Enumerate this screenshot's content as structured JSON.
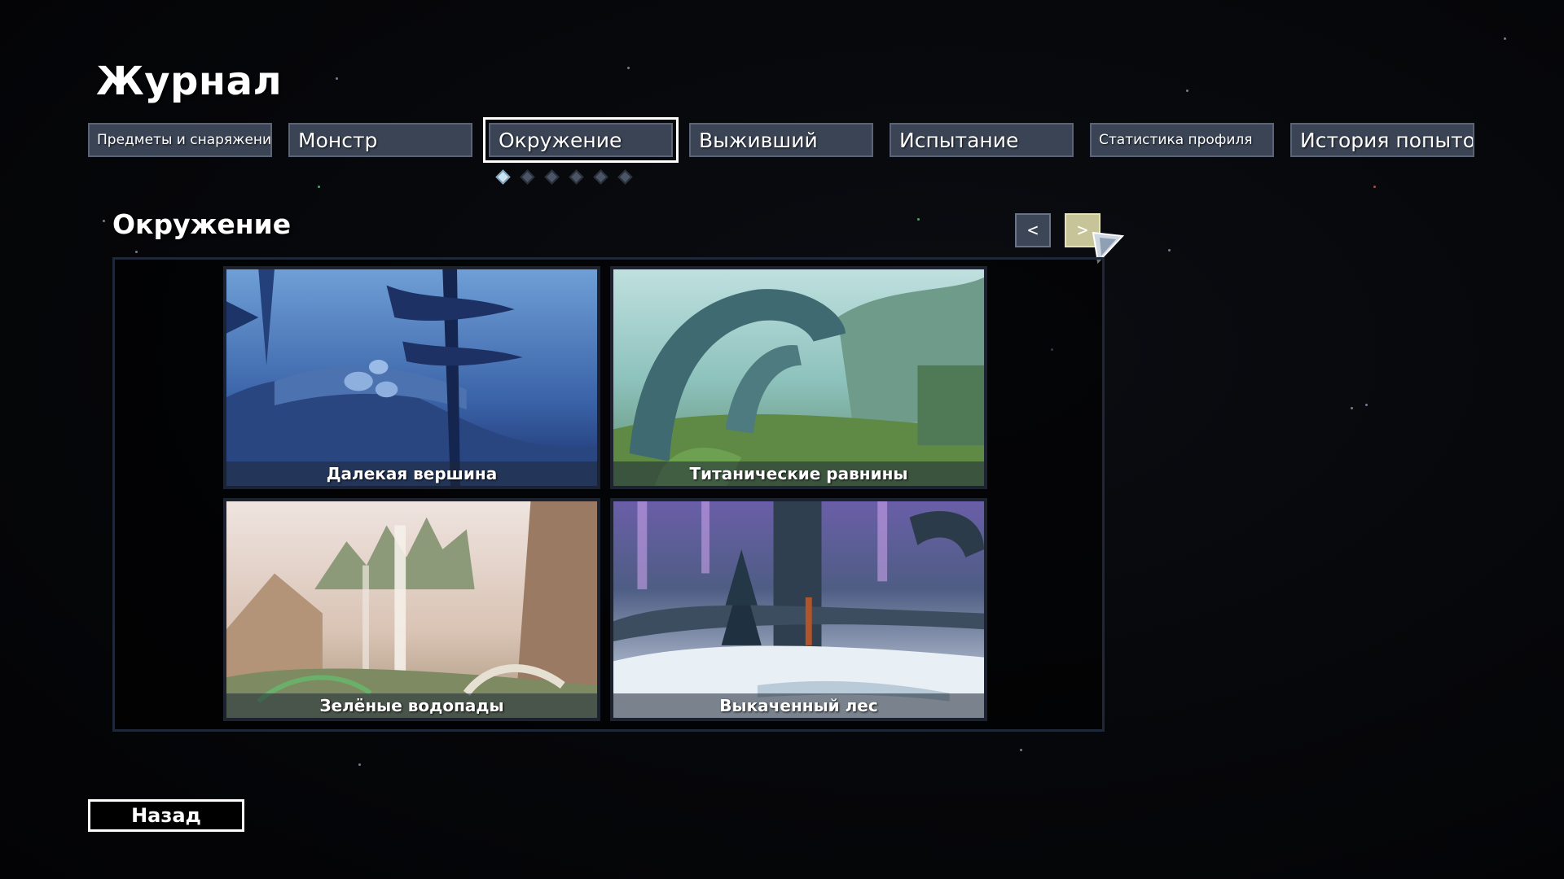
{
  "header": {
    "title": "Журнал"
  },
  "tabs": [
    {
      "label": "Предметы и снаряжение"
    },
    {
      "label": "Монстр"
    },
    {
      "label": "Окружение",
      "active": true
    },
    {
      "label": "Выживший"
    },
    {
      "label": "Испытание"
    },
    {
      "label": "Статистика профиля"
    },
    {
      "label": "История попыток"
    }
  ],
  "page_indicator": {
    "count": 6,
    "current": 1
  },
  "section": {
    "title": "Окружение",
    "prev_label": "<",
    "next_label": ">"
  },
  "environments": [
    {
      "name": "Далекая вершина"
    },
    {
      "name": "Титанические равнины"
    },
    {
      "name": "Зелёные водопады"
    },
    {
      "name": "Выкаченный лес"
    }
  ],
  "footer": {
    "back_label": "Назад"
  },
  "colors": {
    "background": "#050608",
    "tab_fill": "#3a4455",
    "next_button": "#c7c49a",
    "active_dot": "#cfe4f2"
  }
}
